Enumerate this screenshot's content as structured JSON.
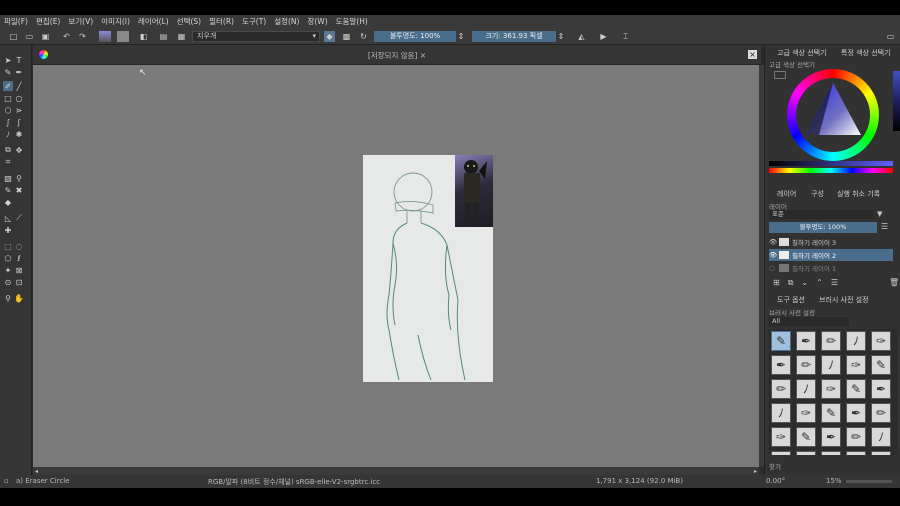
{
  "menu": [
    "파일(F)",
    "편집(E)",
    "보기(V)",
    "이미지(I)",
    "레이어(L)",
    "선택(S)",
    "필터(R)",
    "도구(T)",
    "설정(N)",
    "창(W)",
    "도움말(H)"
  ],
  "toolbar": {
    "brush_preset": "지우개",
    "opacity_label": "불투명도: 100%",
    "size_label": "크기: 361.93 픽셀"
  },
  "document": {
    "title": "[저장되지 않음]"
  },
  "dock": {
    "color_tab_advanced": "고급 색상 선택기",
    "color_tab_specific": "특정 색상 선택기",
    "color_subtitle": "고급 색상 선택기",
    "tabs": [
      "레이어",
      "구성",
      "실행 취소 기록"
    ],
    "layers_subtitle": "레이어",
    "blend_mode": "표준",
    "layer_opacity": "불투명도: 100%",
    "layers": [
      {
        "name": "칠하기 레이어 3",
        "active": false
      },
      {
        "name": "칠하기 레이어 2",
        "active": true
      },
      {
        "name": "칠하기 레이어 1",
        "active": false
      }
    ],
    "brush_tabs": [
      "도구 옵션",
      "브러시 사전 설정"
    ],
    "brush_subtitle": "브러시 사전 설정",
    "brush_filter": "All",
    "search_label": "찾기"
  },
  "status": {
    "tool": "a) Eraser Circle",
    "color_profile": "RGB/알파 (8비트 정수/채널)  sRGB-elle-V2-srgbtrc.icc",
    "dimensions": "1,791 x 3,124 (92.0 MiB)",
    "rotation": "0.00°",
    "zoom": "15%"
  },
  "colors": {
    "accent": "#4a6d8c",
    "panel": "#323232",
    "canvas_bg": "#7a7a7a",
    "paper": "#e6e9e7",
    "sketch": "#4f8a80"
  }
}
